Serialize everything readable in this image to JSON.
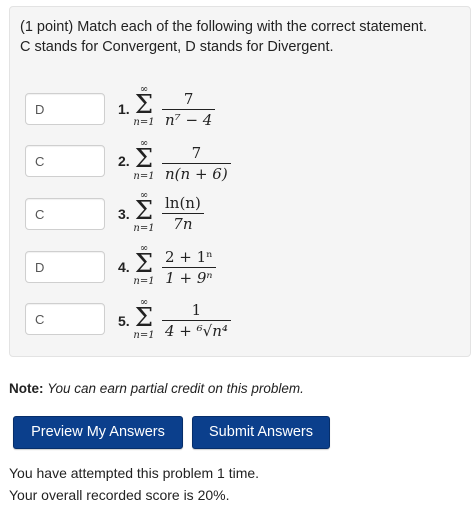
{
  "problem": {
    "prompt_line1": "(1 point) Match each of the following with the correct statement.",
    "prompt_line2": "C stands for Convergent, D stands for Divergent."
  },
  "items": [
    {
      "answer": "D",
      "number": "1.",
      "sum_top": "∞",
      "sum_bottom": "n=1",
      "numerator": "7",
      "denominator": "n⁷ − 4"
    },
    {
      "answer": "C",
      "number": "2.",
      "sum_top": "∞",
      "sum_bottom": "n=1",
      "numerator": "7",
      "denominator": "n(n + 6)"
    },
    {
      "answer": "C",
      "number": "3.",
      "sum_top": "∞",
      "sum_bottom": "n=1",
      "numerator": "ln(n)",
      "denominator": "7n"
    },
    {
      "answer": "D",
      "number": "4.",
      "sum_top": "∞",
      "sum_bottom": "n=1",
      "numerator": "2 + 1ⁿ",
      "denominator": "1 + 9ⁿ"
    },
    {
      "answer": "C",
      "number": "5.",
      "sum_top": "∞",
      "sum_bottom": "n=1",
      "numerator": "1",
      "denominator": "4 + ⁶√n⁴"
    }
  ],
  "note": {
    "label": "Note:",
    "text": "You can earn partial credit on this problem."
  },
  "buttons": {
    "preview": "Preview My Answers",
    "submit": "Submit Answers"
  },
  "status": {
    "attempts": "You have attempted this problem 1 time.",
    "score": "Your overall recorded score is 20%."
  }
}
